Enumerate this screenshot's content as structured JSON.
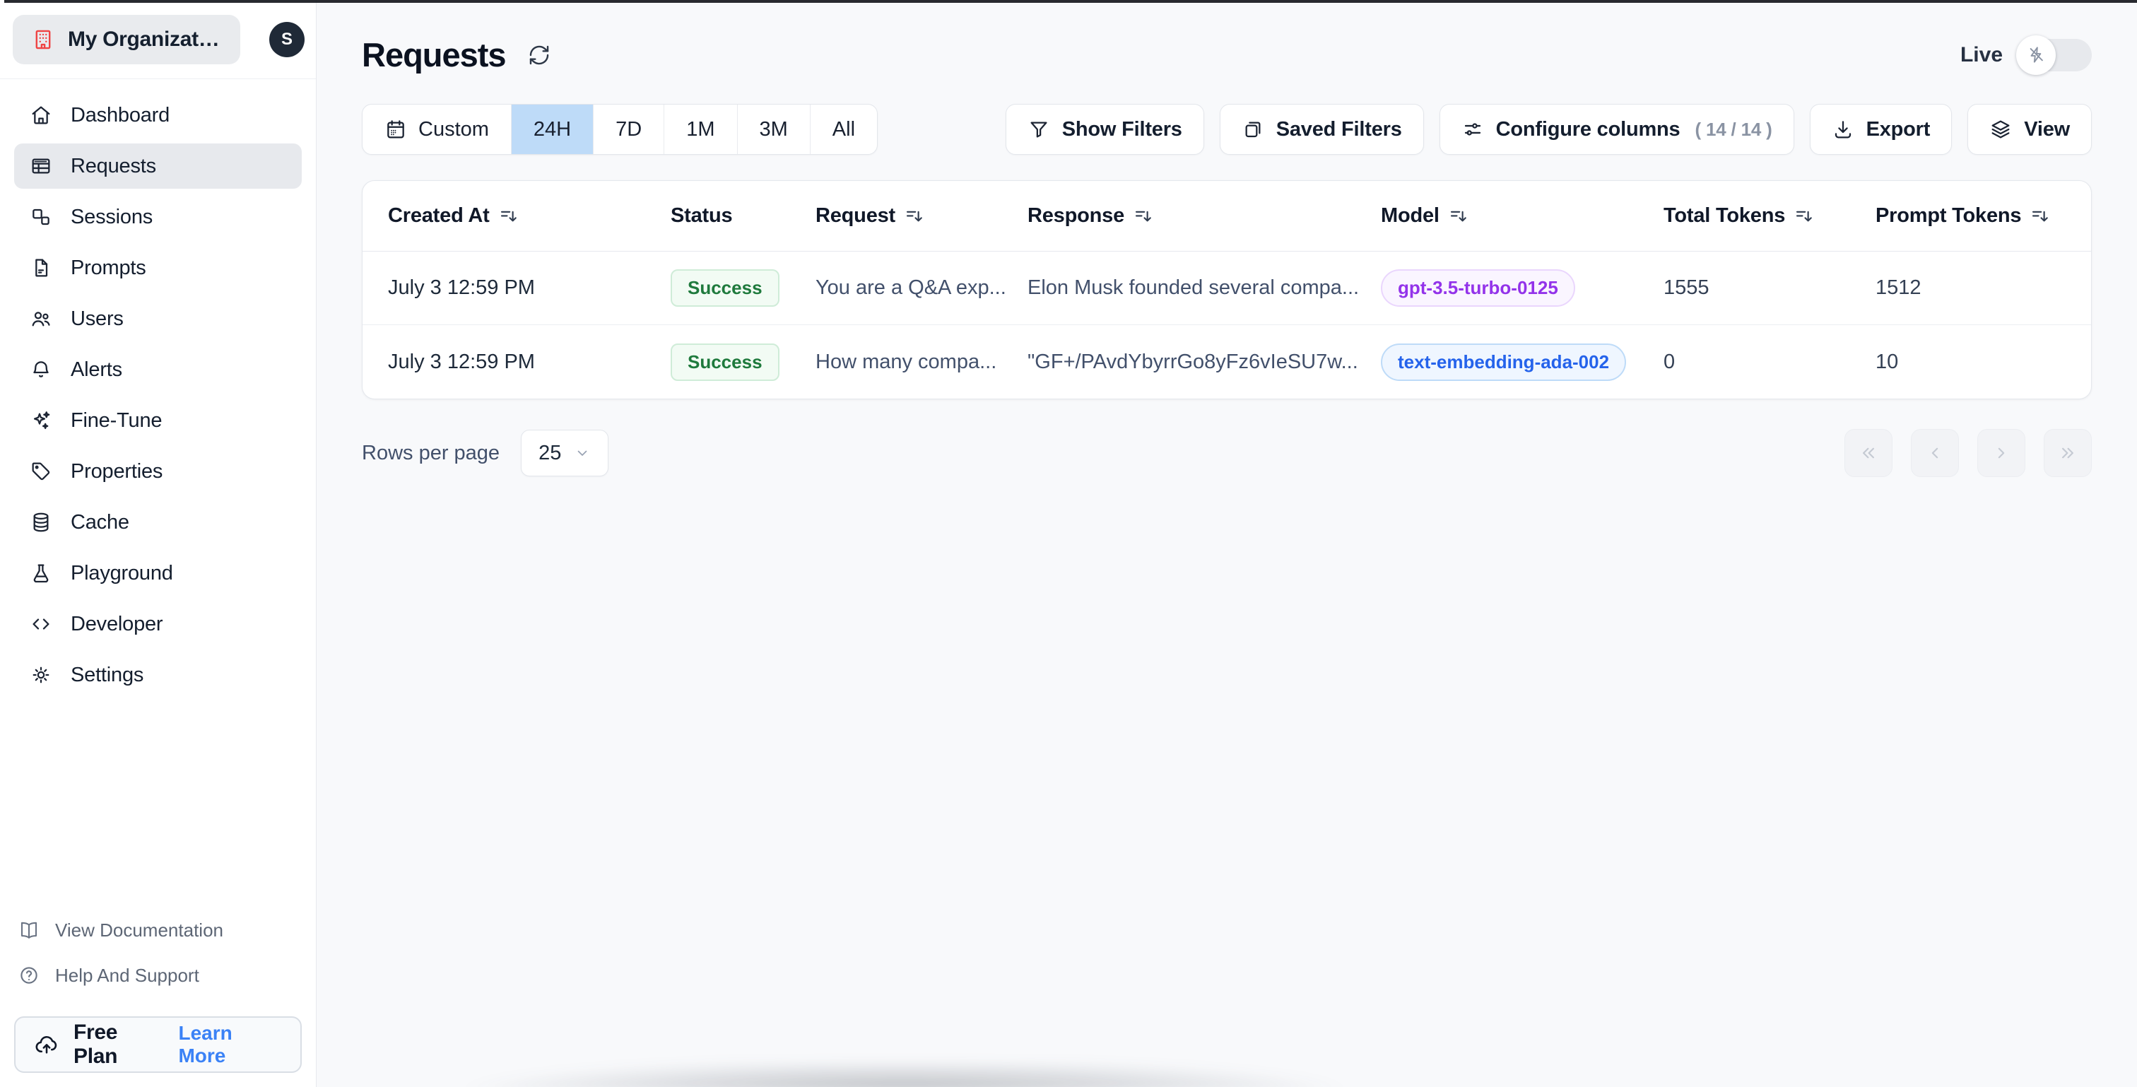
{
  "org": {
    "name": "My Organizatio...",
    "avatar_initial": "S"
  },
  "sidebar": {
    "items": [
      {
        "label": "Dashboard",
        "icon": "home-icon"
      },
      {
        "label": "Requests",
        "icon": "table-icon",
        "active": true
      },
      {
        "label": "Sessions",
        "icon": "squares-icon"
      },
      {
        "label": "Prompts",
        "icon": "file-text-icon"
      },
      {
        "label": "Users",
        "icon": "users-icon"
      },
      {
        "label": "Alerts",
        "icon": "bell-icon"
      },
      {
        "label": "Fine-Tune",
        "icon": "sparkles-icon"
      },
      {
        "label": "Properties",
        "icon": "tag-icon"
      },
      {
        "label": "Cache",
        "icon": "database-icon"
      },
      {
        "label": "Playground",
        "icon": "flask-icon"
      },
      {
        "label": "Developer",
        "icon": "code-icon"
      },
      {
        "label": "Settings",
        "icon": "gear-icon"
      }
    ],
    "footer_links": [
      {
        "label": "View Documentation",
        "icon": "book-open-icon"
      },
      {
        "label": "Help And Support",
        "icon": "help-circle-icon"
      }
    ],
    "plan": {
      "label": "Free Plan",
      "icon": "cloud-upload-icon",
      "action_label": "Learn More"
    }
  },
  "header": {
    "title": "Requests",
    "live_label": "Live",
    "live_enabled": false
  },
  "toolbar": {
    "time_ranges": {
      "custom": "Custom",
      "h24": "24H",
      "d7": "7D",
      "m1": "1M",
      "m3": "3M",
      "all": "All",
      "selected": "24H"
    },
    "show_filters_label": "Show Filters",
    "saved_filters_label": "Saved Filters",
    "configure_columns_label": "Configure columns",
    "configure_columns_count": "( 14 / 14 )",
    "export_label": "Export",
    "view_label": "View"
  },
  "table": {
    "columns": [
      {
        "label": "Created At",
        "sortable": true
      },
      {
        "label": "Status",
        "sortable": false
      },
      {
        "label": "Request",
        "sortable": true
      },
      {
        "label": "Response",
        "sortable": true
      },
      {
        "label": "Model",
        "sortable": true
      },
      {
        "label": "Total Tokens",
        "sortable": true
      },
      {
        "label": "Prompt Tokens",
        "sortable": true
      }
    ],
    "rows": [
      {
        "created_at": "July 3 12:59 PM",
        "status": "Success",
        "request": "You are a Q&A exp...",
        "response": "Elon Musk founded several compa...",
        "model": "gpt-3.5-turbo-0125",
        "model_variant": "purple",
        "total_tokens": "1555",
        "prompt_tokens": "1512"
      },
      {
        "created_at": "July 3 12:59 PM",
        "status": "Success",
        "request": "How many compa...",
        "response": "\"GF+/PAvdYbyrrGo8yFz6vIeSU7w...",
        "model": "text-embedding-ada-002",
        "model_variant": "blue",
        "total_tokens": "0",
        "prompt_tokens": "10"
      }
    ]
  },
  "pagination": {
    "rows_per_page_label": "Rows per page",
    "rows_per_page_value": "25"
  },
  "colors": {
    "accent_blue": "#3b82f6",
    "selected_range_bg": "#bedbf8",
    "success_green": "#1f7a3d",
    "model_purple": "#9333ea",
    "model_blue": "#2563eb",
    "avatar_bg": "#1f2937",
    "org_icon_red": "#ef4444"
  }
}
